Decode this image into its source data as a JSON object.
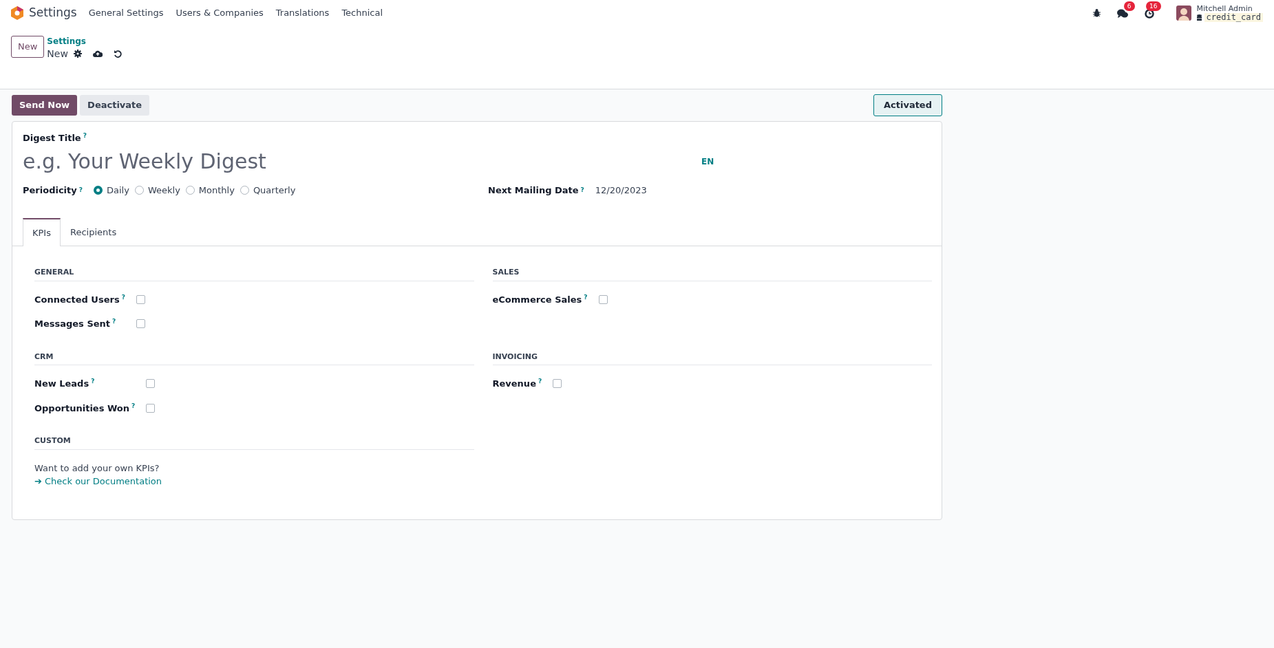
{
  "navbar": {
    "app_name": "Settings",
    "menus": [
      "General Settings",
      "Users & Companies",
      "Translations",
      "Technical"
    ],
    "messages_count": "6",
    "activities_count": "16",
    "user_name": "Mitchell Admin",
    "database": "credit_card"
  },
  "control_panel": {
    "new_button": "New",
    "breadcrumb": "Settings",
    "current": "New"
  },
  "statusbar": {
    "buttons": [
      {
        "label": "Send Now",
        "kind": "primary"
      },
      {
        "label": "Deactivate",
        "kind": "secondary"
      }
    ],
    "state_button": "Activated"
  },
  "form": {
    "title_label": "Digest Title",
    "title_help": "?",
    "title_placeholder": "e.g. Your Weekly Digest",
    "language": "EN",
    "periodicity": {
      "label": "Periodicity",
      "help": "?",
      "options": [
        {
          "label": "Daily",
          "selected": true
        },
        {
          "label": "Weekly",
          "selected": false
        },
        {
          "label": "Monthly",
          "selected": false
        },
        {
          "label": "Quarterly",
          "selected": false
        }
      ]
    },
    "next_mailing": {
      "label": "Next Mailing Date",
      "help": "?",
      "value": "12/20/2023"
    },
    "tabs": [
      {
        "label": "KPIs",
        "selected": true
      },
      {
        "label": "Recipients",
        "selected": false
      }
    ],
    "sections": [
      {
        "title": "GENERAL",
        "kind": "checkboxes",
        "fields": [
          {
            "label": "Connected Users",
            "help": "?",
            "checked": false
          },
          {
            "label": "Messages Sent",
            "help": "?",
            "checked": false
          }
        ]
      },
      {
        "title": "SALES",
        "kind": "checkboxes",
        "fields": [
          {
            "label": "eCommerce Sales",
            "help": "?",
            "checked": false
          }
        ]
      },
      {
        "title": "CRM",
        "kind": "checkboxes",
        "fields": [
          {
            "label": "New Leads",
            "help": "?",
            "checked": false
          },
          {
            "label": "Opportunities Won",
            "help": "?",
            "checked": false
          }
        ]
      },
      {
        "title": "INVOICING",
        "kind": "checkboxes",
        "fields": [
          {
            "label": "Revenue",
            "help": "?",
            "checked": false
          }
        ]
      },
      {
        "title": "CUSTOM",
        "kind": "text",
        "text": "Want to add your own KPIs?",
        "link": "➔ Check our Documentation"
      }
    ]
  }
}
